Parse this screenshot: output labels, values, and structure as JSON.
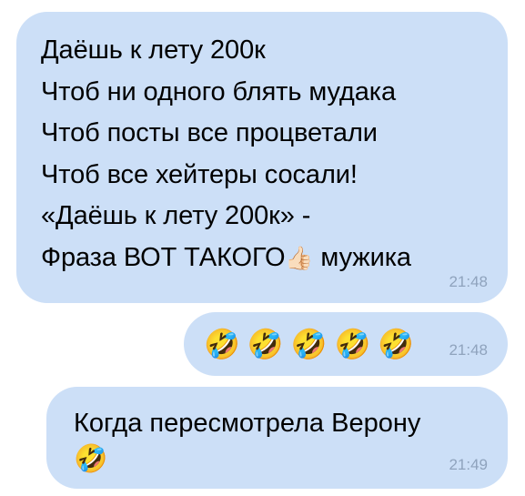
{
  "messages": [
    {
      "lines": [
        "Даёшь к лету 200к",
        "Чтоб ни одного блять мудака",
        "Чтоб посты все процветали",
        "Чтоб все хейтеры сосали!",
        "«Даёшь к лету 200к» -"
      ],
      "last_line_before": "Фраза ВОТ ТАКОГО",
      "last_line_emoji": "👍🏻",
      "last_line_after": " мужика",
      "time": "21:48"
    },
    {
      "emojis": "🤣🤣🤣🤣🤣",
      "time": "21:48"
    },
    {
      "text": "Когда пересмотрела Верону",
      "emoji": "🤣",
      "time": "21:49"
    }
  ],
  "colors": {
    "bubble": "#ccdff7",
    "time": "#8fa3bd",
    "background": "#ffffff"
  },
  "icons": {
    "thumb": "thumbs-up-light-skin-icon",
    "laugh": "rolling-on-floor-laughing-icon"
  }
}
